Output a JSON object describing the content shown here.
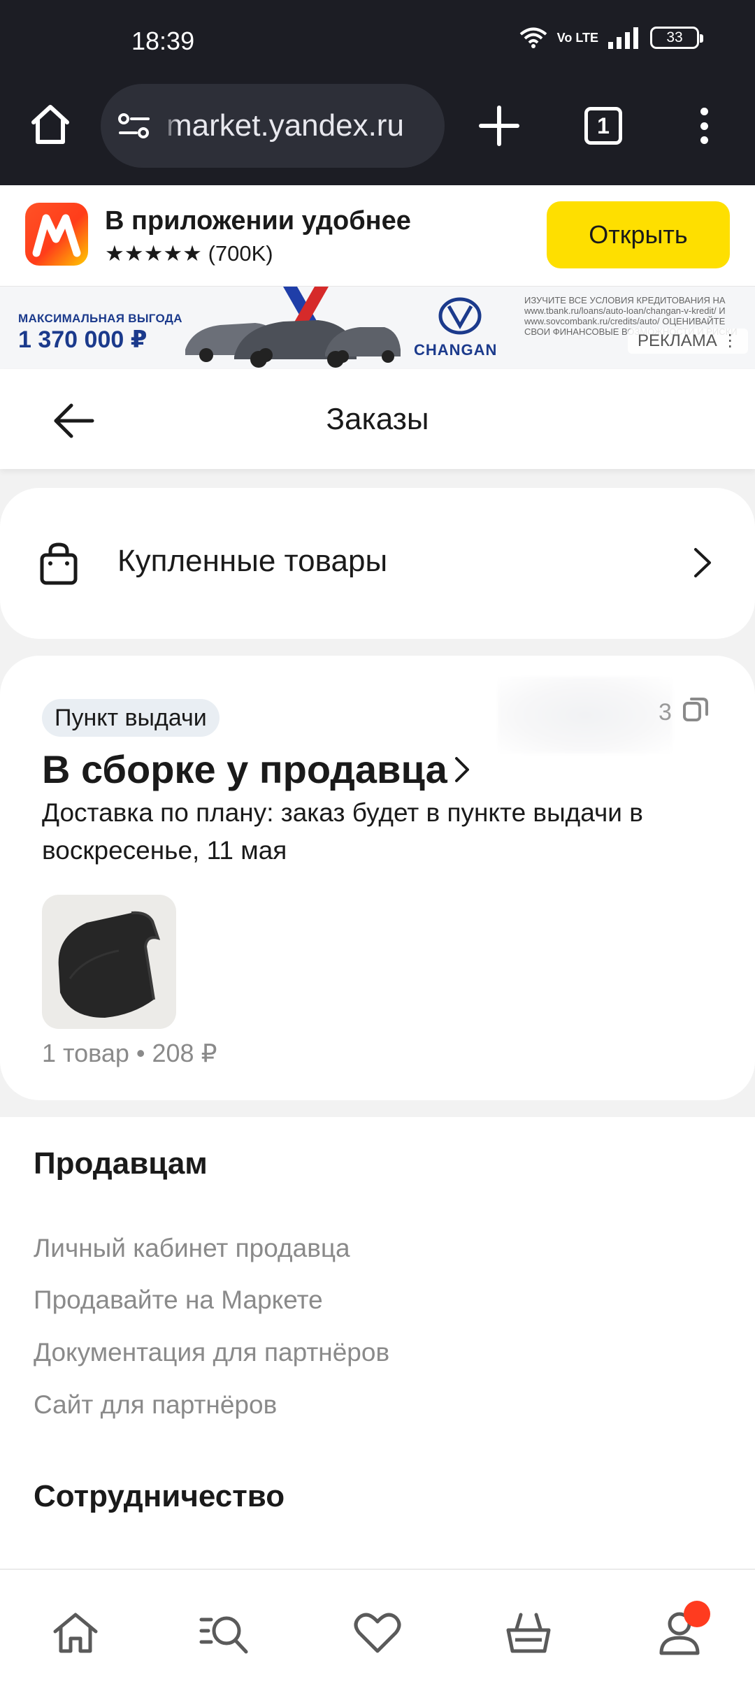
{
  "status_bar": {
    "time": "18:39",
    "network": "Vo LTE",
    "battery": "33",
    "icons": [
      "wifi-icon",
      "volte-icon",
      "signal-icon",
      "battery-icon"
    ]
  },
  "browser": {
    "url": "market.yandex.ru",
    "tab_count": "1"
  },
  "app_promo": {
    "title": "В приложении удобнее",
    "rating": "★★★★★ (700K)",
    "open_label": "Открыть"
  },
  "ad": {
    "headline": "МАКСИМАЛЬНАЯ ВЫГОДА",
    "amount": "1 370 000 ₽",
    "brand": "CHANGAN",
    "fine_print": "ИЗУЧИТЕ ВСЕ УСЛОВИЯ КРЕДИТОВАНИЯ НА www.tbank.ru/loans/auto-loan/changan-v-kredit/ И www.sovcombank.ru/credits/auto/ ОЦЕНИВАЙТЕ СВОИ ФИНАНСОВЫЕ ВОЗМОЖНОСТИ И РИСКИ",
    "label": "РЕКЛАМА ⋮"
  },
  "page": {
    "title": "Заказы"
  },
  "purchased": {
    "label": "Купленные товары"
  },
  "order": {
    "delivery_type": "Пункт выдачи",
    "status": "В сборке у продавца",
    "description": "Доставка по плану: заказ будет в пункте выдачи в воскресенье, 11 мая",
    "summary": "1 товар • 208 ₽",
    "order_number_tail": "3"
  },
  "footer": {
    "sellers_heading": "Продавцам",
    "sellers_links": [
      "Личный кабинет продавца",
      "Продавайте на Маркете",
      "Документация для партнёров",
      "Сайт для партнёров"
    ],
    "cooperation_heading": "Сотрудничество"
  },
  "bottom_nav": {
    "items": [
      "home-icon",
      "catalog-search-icon",
      "favorites-icon",
      "cart-icon",
      "profile-icon"
    ]
  },
  "colors": {
    "accent_yellow": "#fedf00",
    "brand_red": "#ff3b1f",
    "chrome_bg": "#1c1d24",
    "muted_text": "#8a8a8a"
  }
}
